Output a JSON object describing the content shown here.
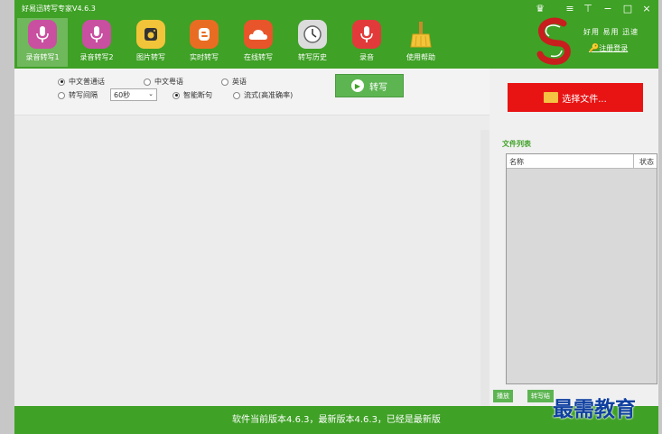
{
  "app": {
    "title": "好易迅转写专家V4.6.3"
  },
  "window_controls": [
    "≡",
    "⊤",
    "−",
    "□",
    "×"
  ],
  "toolbar": {
    "items": [
      {
        "label": "录音转写1",
        "icon": "microphone-icon",
        "color": "#c94fa0"
      },
      {
        "label": "录音转写2",
        "icon": "microphone-icon",
        "color": "#c94fa0"
      },
      {
        "label": "图片转写",
        "icon": "camera-icon",
        "color": "#f2c43a"
      },
      {
        "label": "实时转写",
        "icon": "blogger-icon",
        "color": "#e86d22"
      },
      {
        "label": "在线转写",
        "icon": "cloud-icon",
        "color": "#e8552a"
      },
      {
        "label": "转写历史",
        "icon": "clock-icon",
        "color": "#9a9a9a"
      },
      {
        "label": "录音",
        "icon": "microphone-icon",
        "color": "#e23a3a"
      },
      {
        "label": "使用帮助",
        "icon": "broom-icon",
        "color": "#f2c43a"
      }
    ]
  },
  "brand": {
    "slogan": "好用 易用 迅速",
    "login": "注册登录"
  },
  "options": {
    "lang_mandarin": "中文普通话",
    "lang_cantonese": "中文粤语",
    "lang_english": "英语",
    "interval_label": "转写间隔",
    "interval_value": "60秒",
    "smart_break": "智能断句",
    "streaming": "流式(高准确率)",
    "convert_button": "转写"
  },
  "right_panel": {
    "select_file": "选择文件...",
    "file_list_title": "文件列表",
    "col_name": "名称",
    "col_status": "状态",
    "play_button": "播放",
    "convert_button": "转写结"
  },
  "statusbar": {
    "text": "软件当前版本4.6.3，最新版本4.6.3，已经是最新版"
  },
  "watermark": "最需教育",
  "colors": {
    "accent": "#3fa126",
    "red_button": "#e81414"
  }
}
